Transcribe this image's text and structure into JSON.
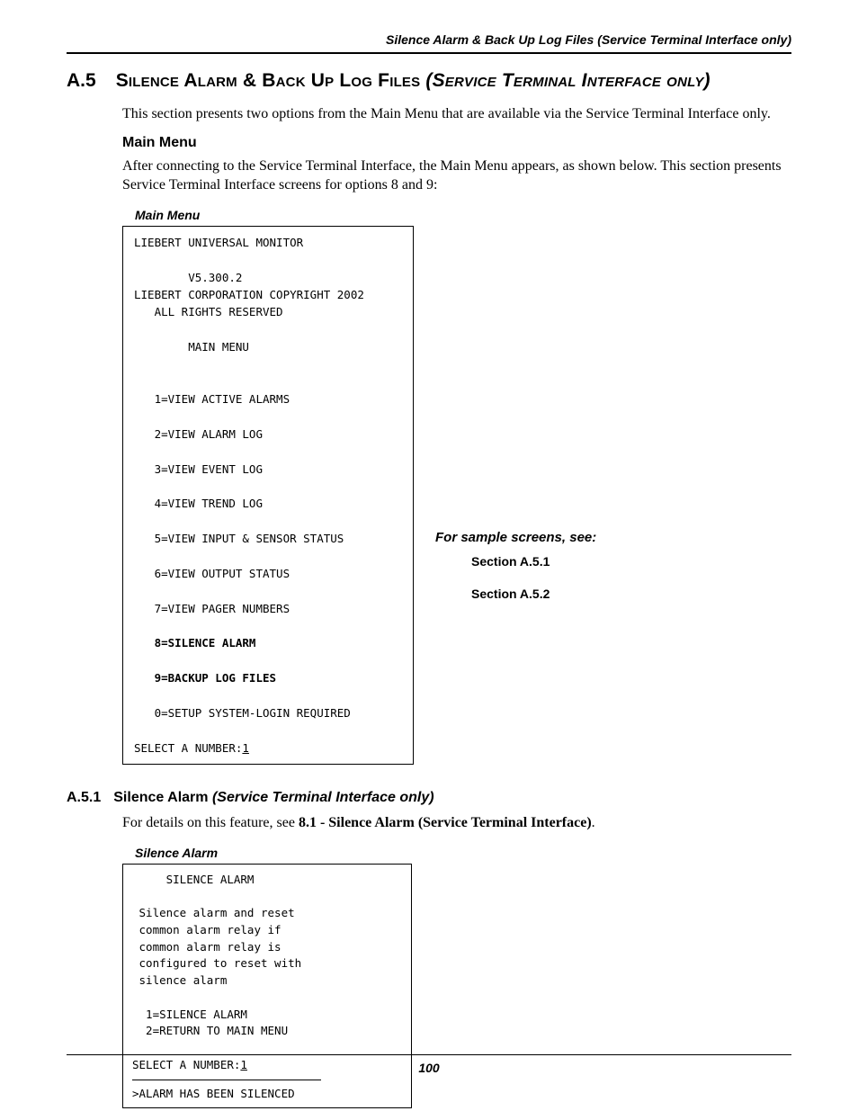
{
  "runningHead": "Silence Alarm & Back Up Log Files (Service Terminal Interface only)",
  "section": {
    "number": "A.5",
    "title_sc": "Silence Alarm & Back Up Log Files ",
    "title_sc_ital": "(Service Terminal Interface only)"
  },
  "intro": "This section presents two options from the Main Menu that are available via the Service Terminal Interface only.",
  "mainMenu": {
    "heading": "Main Menu",
    "para": "After connecting to the Service Terminal Interface, the Main Menu appears, as shown below. This section presents Service Terminal Interface screens for options 8 and 9:",
    "figLabel": "Main Menu",
    "lines": {
      "l1": "LIEBERT UNIVERSAL MONITOR",
      "l2": "        V5.300.2",
      "l3": "LIEBERT CORPORATION COPYRIGHT 2002",
      "l4": "   ALL RIGHTS RESERVED",
      "l5": "        MAIN MENU",
      "m1": "   1=VIEW ACTIVE ALARMS",
      "m2": "   2=VIEW ALARM LOG",
      "m3": "   3=VIEW EVENT LOG",
      "m4": "   4=VIEW TREND LOG",
      "m5": "   5=VIEW INPUT & SENSOR STATUS",
      "m6": "   6=VIEW OUTPUT STATUS",
      "m7": "   7=VIEW PAGER NUMBERS",
      "m8": "   8=SILENCE ALARM",
      "m9": "   9=BACKUP LOG FILES",
      "m0": "   0=SETUP SYSTEM-LOGIN REQUIRED",
      "promptPrefix": "SELECT A NUMBER:",
      "promptVal": "1"
    },
    "side": {
      "lead": "For sample screens, see:",
      "ref1": "Section A.5.1",
      "ref2": "Section A.5.2"
    }
  },
  "sub": {
    "number": "A.5.1",
    "title": "Silence Alarm ",
    "title_ital": "(Service Terminal Interface only)",
    "para_pre": "For details on this feature, see ",
    "para_bold": "8.1 - Silence Alarm (Service Terminal Interface)",
    "para_post": ".",
    "figLabel": "Silence Alarm",
    "lines": {
      "t1": "     SILENCE ALARM",
      "t2": " Silence alarm and reset",
      "t3": " common alarm relay if",
      "t4": " common alarm relay is",
      "t5": " configured to reset with",
      "t6": " silence alarm",
      "o1": "  1=SILENCE ALARM",
      "o2": "  2=RETURN TO MAIN MENU",
      "promptPrefix": "SELECT A NUMBER:",
      "promptVal": "1",
      "result": ">ALARM HAS BEEN SILENCED"
    }
  },
  "pageNumber": "100"
}
